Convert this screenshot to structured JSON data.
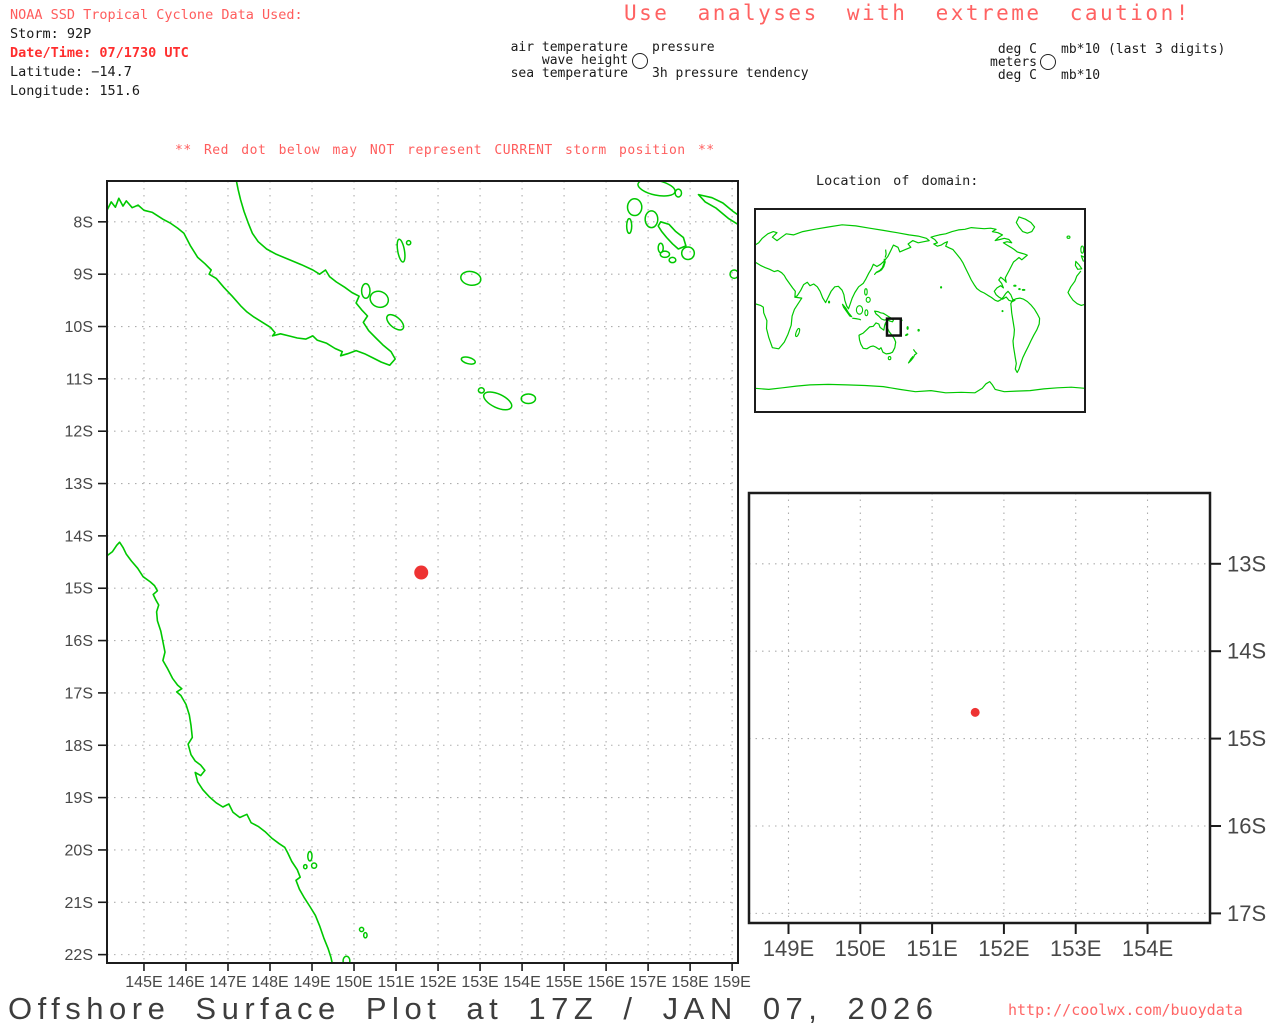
{
  "colors": {
    "coastline": "#00c800",
    "storm_dot": "#ee3333",
    "grid": "#adadad",
    "frame": "#1c1c1c",
    "salmon_text": "#ff5c5c",
    "bold_red_text": "#ff2e2e",
    "axis_text": "#474747"
  },
  "header": {
    "noaa": "NOAA SSD Tropical Cyclone Data Used:",
    "storm": "Storm: 92P",
    "datetime": "Date/Time: 07/1730 UTC",
    "latitude": "Latitude: −14.7",
    "longitude": "Longitude: 151.6"
  },
  "caution": "Use analyses with extreme caution!",
  "station_legend": {
    "left": {
      "air": "air temperature",
      "wave": "wave height",
      "sea": "sea temperature",
      "pressure": "pressure",
      "tendency": "3h pressure tendency",
      "symbol": "station-circle"
    },
    "right": {
      "air_units": "deg C",
      "wave_units": "meters",
      "sea_units": "deg C",
      "pressure_units": "mb*10 (last 3 digits)",
      "tendency_units": "mb*10",
      "symbol": "station-circle"
    }
  },
  "warning": "** Red dot below may NOT represent CURRENT storm position **",
  "inset": {
    "title": "Location of domain:"
  },
  "main_map": {
    "lon_ticks": [
      "145E",
      "146E",
      "147E",
      "148E",
      "149E",
      "150E",
      "151E",
      "152E",
      "153E",
      "154E",
      "155E",
      "156E",
      "157E",
      "158E",
      "159E"
    ],
    "lon_values": [
      145,
      146,
      147,
      148,
      149,
      150,
      151,
      152,
      153,
      154,
      155,
      156,
      157,
      158,
      159
    ],
    "lat_ticks": [
      "8S",
      "9S",
      "10S",
      "11S",
      "12S",
      "13S",
      "14S",
      "15S",
      "16S",
      "17S",
      "18S",
      "19S",
      "20S",
      "21S",
      "22S"
    ],
    "lat_values": [
      8,
      9,
      10,
      11,
      12,
      13,
      14,
      15,
      16,
      17,
      18,
      19,
      20,
      21,
      22
    ],
    "storm": {
      "lon": 151.6,
      "lat_s": 14.7
    }
  },
  "zoom_map": {
    "lon_ticks": [
      "149E",
      "150E",
      "151E",
      "152E",
      "153E",
      "154E"
    ],
    "lon_values": [
      149,
      150,
      151,
      152,
      153,
      154
    ],
    "lat_ticks": [
      "13S",
      "14S",
      "15S",
      "16S",
      "17S"
    ],
    "lat_values": [
      13,
      14,
      15,
      16,
      17
    ],
    "storm": {
      "lon": 151.6,
      "lat_s": 14.7
    }
  },
  "footer": {
    "title": "Offshore Surface Plot at 17Z / JAN 07, 2026",
    "url": "http://coolwx.com/buoydata"
  }
}
